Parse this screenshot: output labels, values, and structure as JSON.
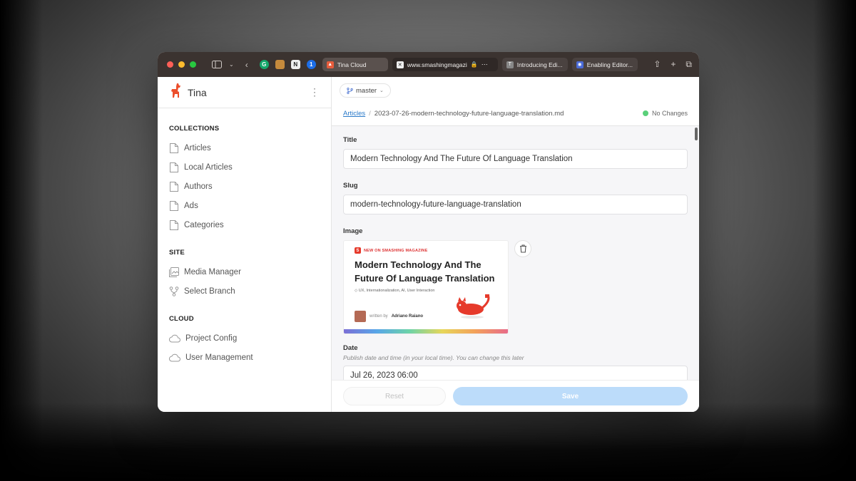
{
  "browser": {
    "tabs": [
      {
        "label": "Tina Cloud",
        "fav_color": "#e65c3c"
      },
      {
        "label": "www.smashingmagazi",
        "fav_color": "#eeeeee"
      },
      {
        "label": "Introducing Edi...",
        "fav_color": "#888888",
        "fav_text": "T"
      },
      {
        "label": "Enabling Editor...",
        "fav_color": "#4a6bd8"
      }
    ]
  },
  "sidebar": {
    "app_name": "Tina",
    "sections": [
      {
        "heading": "COLLECTIONS",
        "items": [
          "Articles",
          "Local Articles",
          "Authors",
          "Ads",
          "Categories"
        ]
      },
      {
        "heading": "SITE",
        "items": [
          "Media Manager",
          "Select Branch"
        ]
      },
      {
        "heading": "CLOUD",
        "items": [
          "Project Config",
          "User Management"
        ]
      }
    ]
  },
  "header": {
    "branch": "master",
    "breadcrumb_collection": "Articles",
    "breadcrumb_separator": "/",
    "breadcrumb_file": "2023-07-26-modern-technology-future-language-translation.md",
    "status": "No Changes"
  },
  "form": {
    "title_label": "Title",
    "title_value": "Modern Technology And The Future Of Language Translation",
    "slug_label": "Slug",
    "slug_value": "modern-technology-future-language-translation",
    "image_label": "Image",
    "image": {
      "tag": "NEW ON SMASHING MAGAZINE",
      "title": "Modern Technology And The Future Of Language Translation",
      "tags": "UX, Internationalization, AI, User Interaction",
      "written_by": "written by",
      "author": "Adriano Raiano"
    },
    "date_label": "Date",
    "date_desc": "Publish date and time (in your local time). You can change this later",
    "date_value": "Jul 26, 2023 06:00"
  },
  "footer": {
    "reset_label": "Reset",
    "save_label": "Save"
  },
  "colors": {
    "accent_link": "#2a7ac9",
    "save_button": "#bcdcfa",
    "status_dot": "#5ad07a"
  }
}
